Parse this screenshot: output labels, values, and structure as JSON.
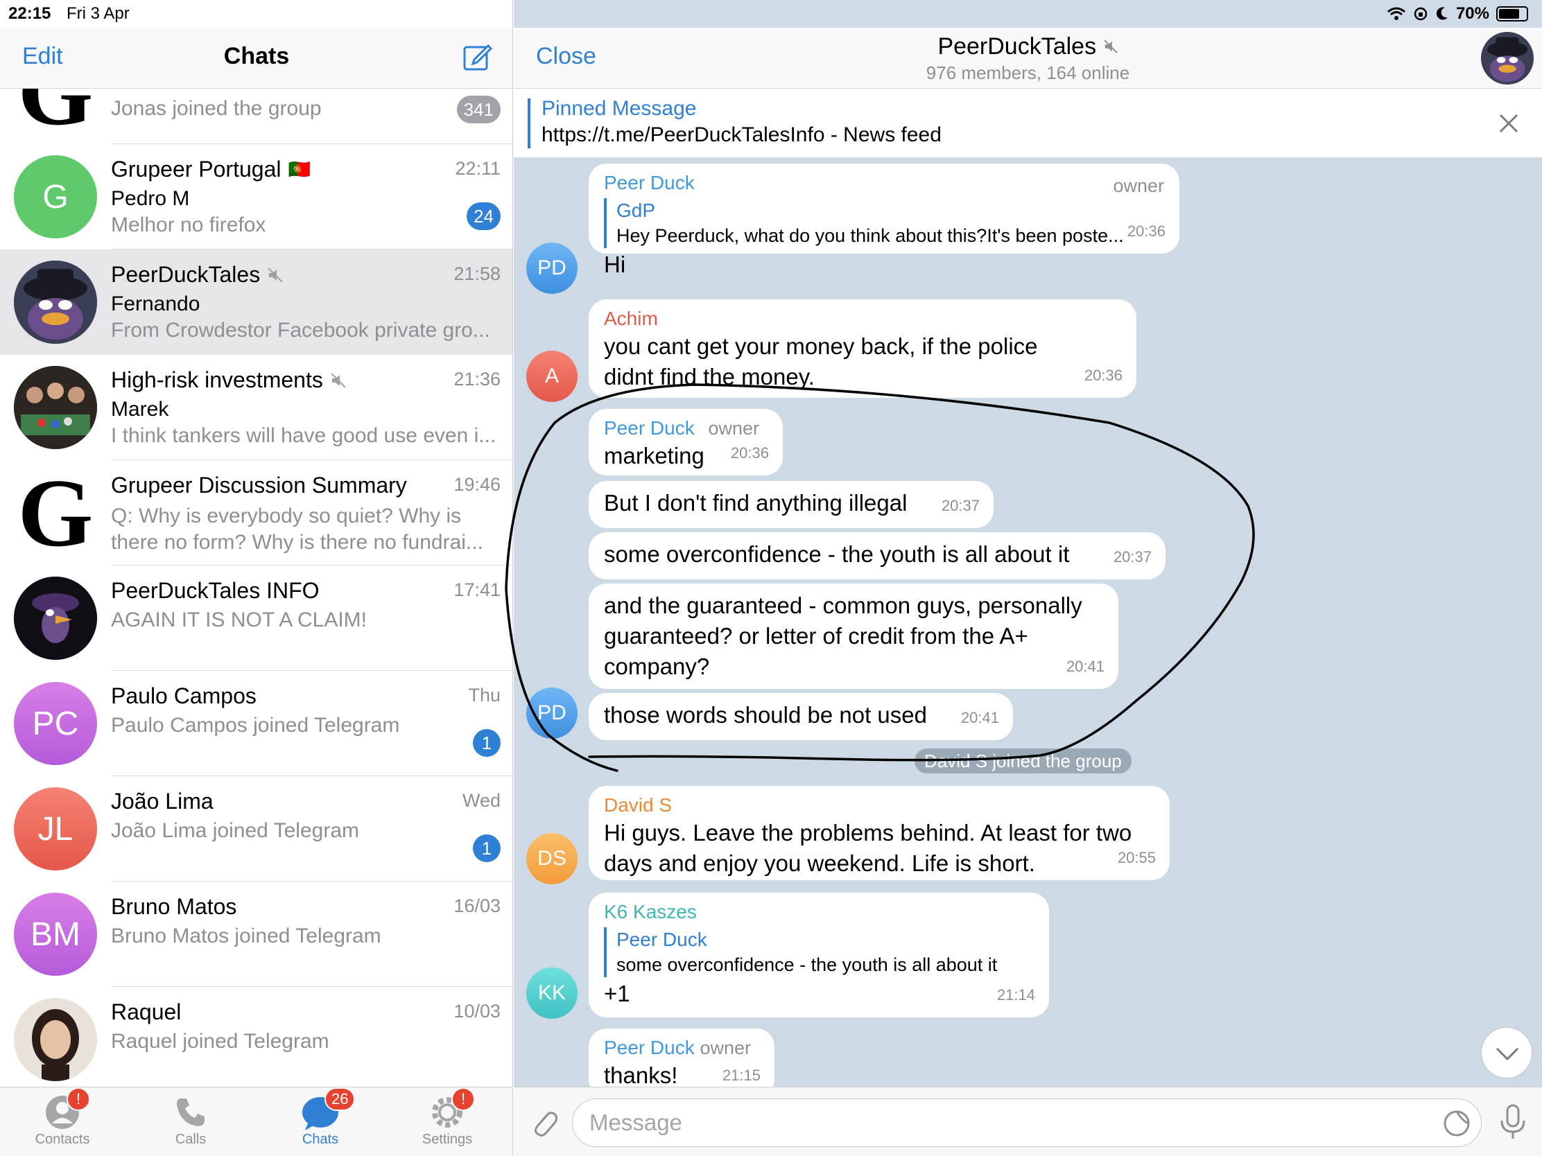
{
  "status_bar": {
    "time": "22:15",
    "date": "Fri 3 Apr",
    "battery": "70%"
  },
  "left_nav": {
    "edit": "Edit",
    "title": "Chats"
  },
  "chat_list": [
    {
      "name": "",
      "preview": "Jonas joined the group",
      "badge": "341",
      "badge_muted": true
    },
    {
      "name": "Grupeer Portugal",
      "flag": "🇵🇹",
      "time": "22:11",
      "sender": "Pedro M",
      "preview": "Melhor no firefox",
      "badge": "24",
      "avatar_letter": "G",
      "avatar_color": "#5fca6b"
    },
    {
      "name": "PeerDuckTales",
      "time": "21:58",
      "sender": "Fernando",
      "preview": "From Crowdestor Facebook private gro...",
      "muted": true
    },
    {
      "name": "High-risk investments",
      "time": "21:36",
      "sender": "Marek",
      "preview": "I think tankers will have good use even i...",
      "muted": true
    },
    {
      "name": "Grupeer Discussion Summary",
      "time": "19:46",
      "preview": "Q: Why is everybody so quiet? Why is there no form? Why is there no fundrai..."
    },
    {
      "name": "PeerDuckTales INFO",
      "time": "17:41",
      "preview": "AGAIN IT IS NOT A CLAIM!"
    },
    {
      "name": "Paulo Campos",
      "time": "Thu",
      "preview": "Paulo Campos joined Telegram",
      "badge": "1",
      "avatar_letter": "PC",
      "avatar_color": "#c66be0"
    },
    {
      "name": "João Lima",
      "time": "Wed",
      "preview": "João Lima joined Telegram",
      "badge": "1",
      "avatar_letter": "JL",
      "avatar_color": "#ef6a5b"
    },
    {
      "name": "Bruno Matos",
      "time": "16/03",
      "preview": "Bruno Matos joined Telegram",
      "avatar_letter": "BM",
      "avatar_color": "#c66be0"
    },
    {
      "name": "Raquel",
      "time": "10/03",
      "preview": "Raquel joined Telegram"
    }
  ],
  "tabs": [
    {
      "label": "Contacts",
      "badge": "!"
    },
    {
      "label": "Calls"
    },
    {
      "label": "Chats",
      "badge": "26"
    },
    {
      "label": "Settings",
      "badge": "!"
    }
  ],
  "right_nav": {
    "close": "Close",
    "title": "PeerDuckTales",
    "subtitle": "976 members, 164 online"
  },
  "pinned": {
    "label": "Pinned Message",
    "text": "https://t.me/PeerDuckTalesInfo - News feed"
  },
  "messages": {
    "m1": {
      "sender": "Peer Duck",
      "tag": "owner",
      "reply_name": "GdP",
      "reply_text": "Hey Peerduck, what do you think about this?It's been poste...",
      "text": "Hi",
      "time": "20:36",
      "avatar": "PD"
    },
    "m2": {
      "sender": "Achim",
      "text": "you cant get your money back, if the police didnt find the money.",
      "time": "20:36",
      "avatar": "A"
    },
    "m3": {
      "sender": "Peer Duck",
      "tag": "owner",
      "text": "marketing",
      "time": "20:36"
    },
    "m4": {
      "text": "But I don't find anything illegal",
      "time": "20:37"
    },
    "m5": {
      "text": "some overconfidence - the youth is all about it",
      "time": "20:37"
    },
    "m6": {
      "text": "and the guaranteed - common guys, personally guaranteed?  or letter of credit from the A+ company?",
      "time": "20:41"
    },
    "m7": {
      "text": "those words should be not used",
      "time": "20:41",
      "avatar": "PD"
    },
    "service": "David S joined the group",
    "m8": {
      "sender": "David S",
      "text": "Hi guys. Leave the problems behind. At least for two days and enjoy you weekend. Life is short.",
      "time": "20:55",
      "avatar": "DS"
    },
    "m9": {
      "sender": "K6 Kaszes",
      "reply_name": "Peer Duck",
      "reply_text": "some overconfidence - the youth is all about it",
      "text": "+1",
      "time": "21:14",
      "avatar": "KK"
    },
    "m10": {
      "sender": "Peer Duck",
      "tag": "owner",
      "text": "thanks!",
      "time": "21:15"
    }
  },
  "input": {
    "placeholder": "Message"
  },
  "colors": {
    "accent": "#2f7fd4",
    "badge_red": "#e5432f",
    "chat_bg": "#cdd9e4"
  }
}
